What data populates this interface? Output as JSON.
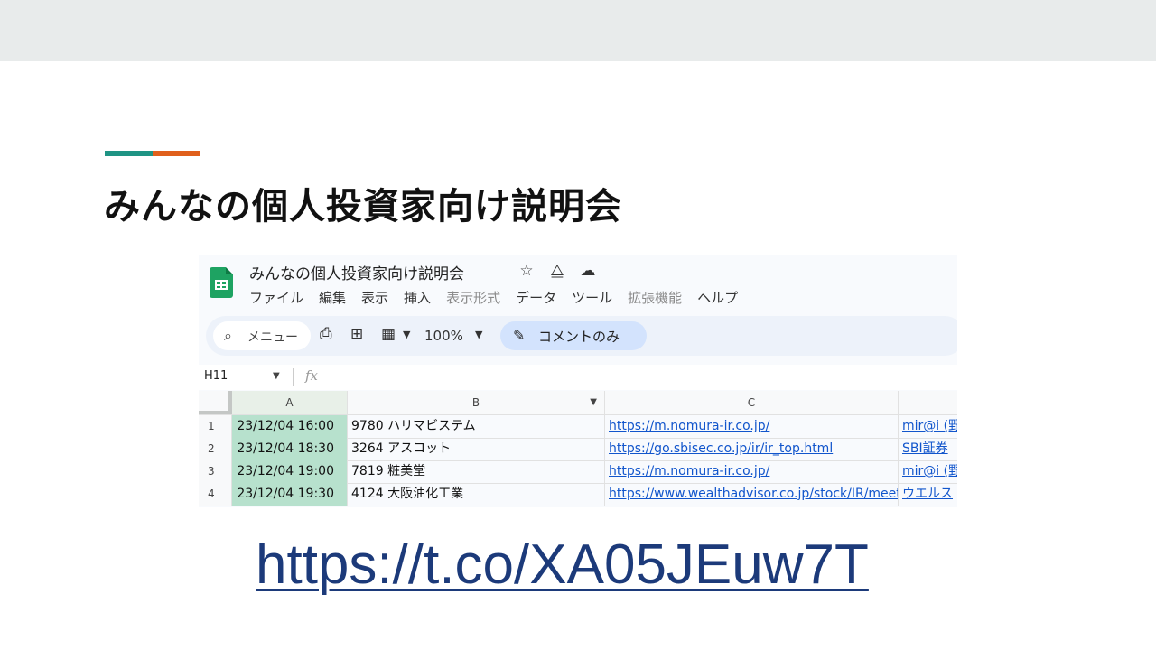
{
  "slide": {
    "title": "みんなの個人投資家向け説明会",
    "link": "https://t.co/XA05JEuw7T",
    "accent_colors": [
      "#1f9484",
      "#e0601c"
    ]
  },
  "sheet": {
    "doc_title": "みんなの個人投資家向け説明会",
    "title_icons": [
      "star-icon",
      "move-to-drive-icon",
      "cloud-saved-icon"
    ],
    "menu": [
      {
        "label": "ファイル",
        "enabled": true
      },
      {
        "label": "編集",
        "enabled": true
      },
      {
        "label": "表示",
        "enabled": true
      },
      {
        "label": "挿入",
        "enabled": true
      },
      {
        "label": "表示形式",
        "enabled": false
      },
      {
        "label": "データ",
        "enabled": true
      },
      {
        "label": "ツール",
        "enabled": true
      },
      {
        "label": "拡張機能",
        "enabled": false
      },
      {
        "label": "ヘルプ",
        "enabled": true
      }
    ],
    "toolbar": {
      "search_label": "メニュー",
      "zoom": "100%",
      "comment_mode": "コメントのみ"
    },
    "name_box": "H11",
    "columns": [
      "A",
      "B",
      "C"
    ],
    "rows": [
      {
        "num": "1",
        "a": "23/12/04 16:00",
        "b": "9780 ハリマビステム",
        "c": "https://m.nomura-ir.co.jp/",
        "d": "mir@i (野"
      },
      {
        "num": "2",
        "a": "23/12/04 18:30",
        "b": "3264 アスコット",
        "c": "https://go.sbisec.co.jp/ir/ir_top.html",
        "d": "SBI証券"
      },
      {
        "num": "3",
        "a": "23/12/04 19:00",
        "b": "7819 粧美堂",
        "c": "https://m.nomura-ir.co.jp/",
        "d": "mir@i (野"
      },
      {
        "num": "4",
        "a": "23/12/04 19:30",
        "b": "4124 大阪油化工業",
        "c": "https://www.wealthadvisor.co.jp/stock/IR/meeting/",
        "d": "ウエルス"
      }
    ],
    "colors": {
      "selected_column": "#b7e1cd",
      "link": "#1155cc",
      "logo": "#1ea362"
    }
  }
}
